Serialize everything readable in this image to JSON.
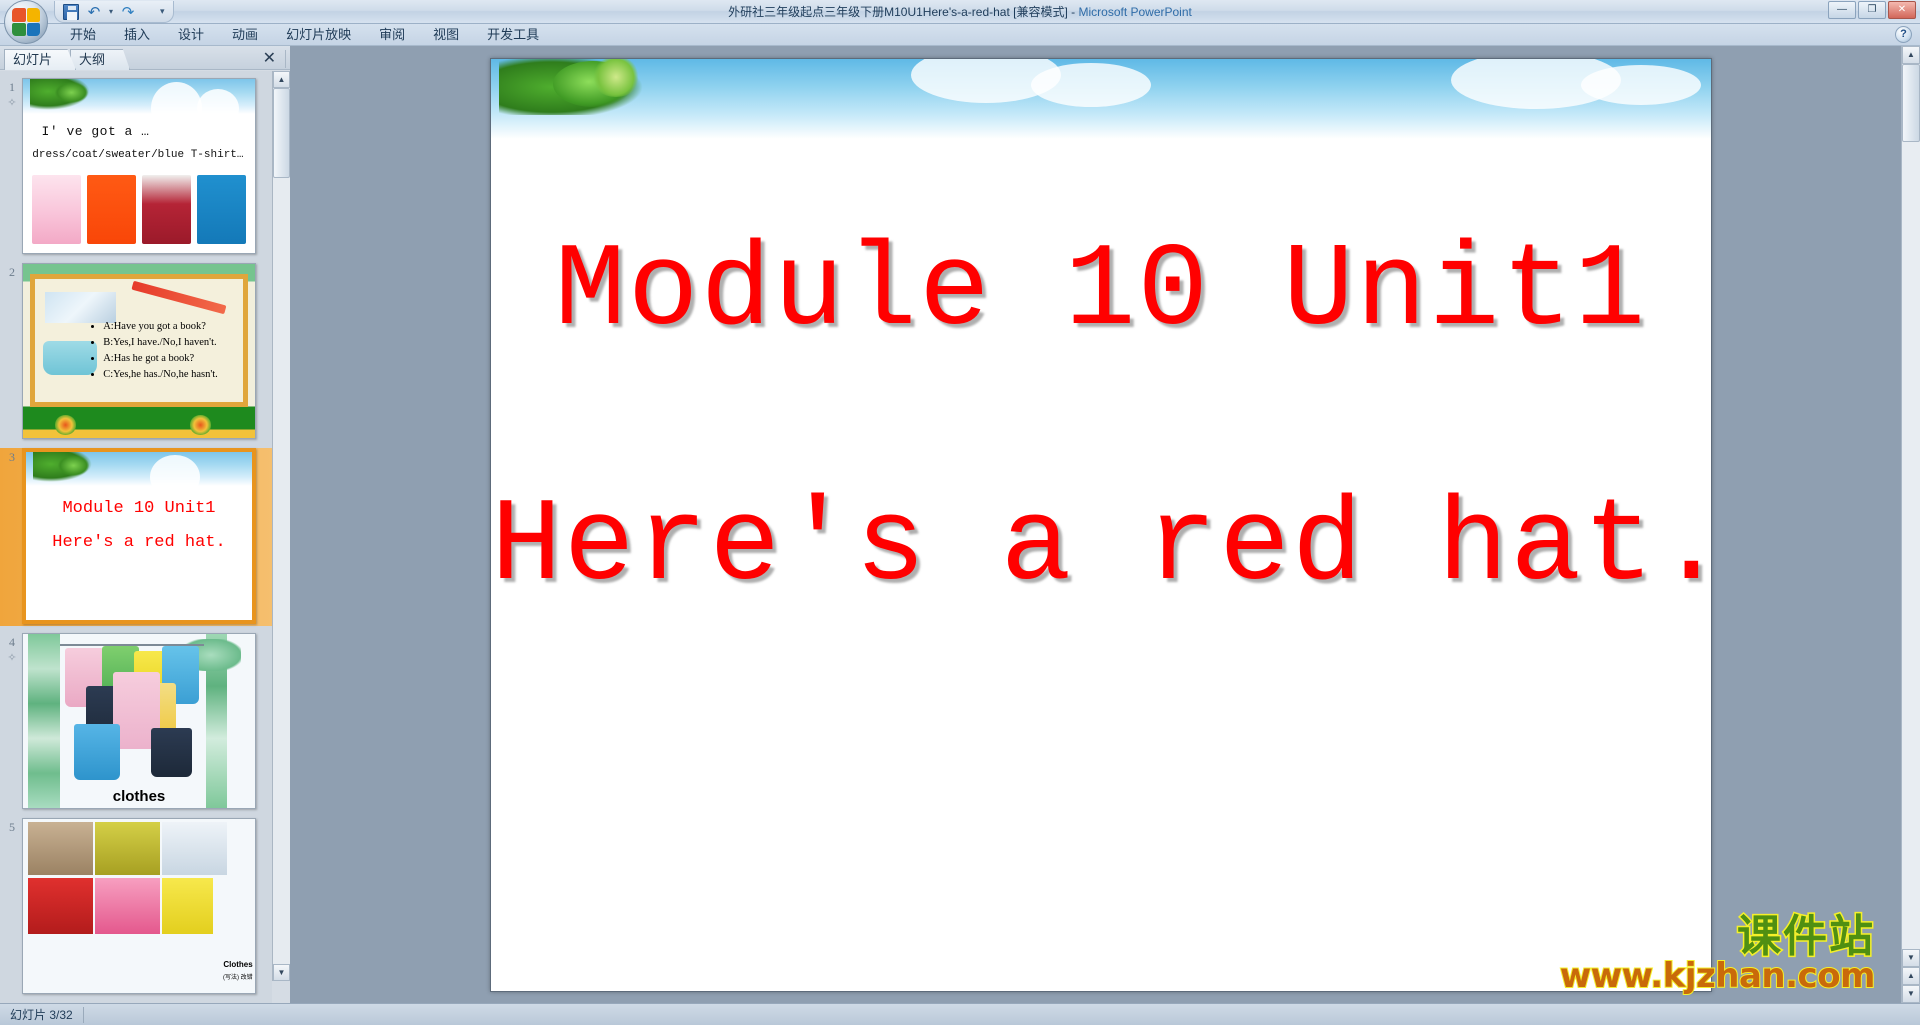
{
  "window": {
    "title": "外研社三年级起点三年级下册M10U1Here's-a-red-hat [兼容模式]",
    "separator": " - ",
    "app_name": "Microsoft PowerPoint",
    "minimize": "—",
    "restore": "❐",
    "close": "✕"
  },
  "quick_access": {
    "save_icon": "save-icon",
    "undo_icon": "undo-icon",
    "redo_icon": "redo-icon",
    "undo_glyph": "↶",
    "redo_glyph": "↷",
    "caret": "▾",
    "more": "▾"
  },
  "ribbon": {
    "tabs": [
      {
        "label": "开始"
      },
      {
        "label": "插入"
      },
      {
        "label": "设计"
      },
      {
        "label": "动画"
      },
      {
        "label": "幻灯片放映"
      },
      {
        "label": "审阅"
      },
      {
        "label": "视图"
      },
      {
        "label": "开发工具"
      }
    ],
    "help_label": "?"
  },
  "left_pane": {
    "tabs": [
      {
        "label": "幻灯片",
        "active": true
      },
      {
        "label": "大纲",
        "active": false
      }
    ],
    "close_label": "✕",
    "scroll": {
      "up": "▲",
      "down": "▼"
    }
  },
  "thumbnails": [
    {
      "number": "1",
      "star": "✧",
      "selected": false,
      "line1": "I' ve got a …",
      "line2": "dress/coat/sweater/blue T-shirt…"
    },
    {
      "number": "2",
      "star": "",
      "selected": false,
      "bullets": [
        "A:Have you got a book?",
        "B:Yes,I have./No,I haven't.",
        "A:Has he got a book?",
        "C:Yes,he has./No,he hasn't."
      ]
    },
    {
      "number": "3",
      "star": "",
      "selected": true,
      "title": "Module 10 Unit1",
      "subtitle": "Here's a red hat."
    },
    {
      "number": "4",
      "star": "✧",
      "selected": false,
      "label": "clothes"
    },
    {
      "number": "5",
      "star": "",
      "selected": false,
      "label": "Clothes",
      "sublabel": "(写法) 改错"
    }
  ],
  "slide": {
    "title": "Module 10 Unit1",
    "subtitle": "Here's a red hat.",
    "title_color": "#ff0000"
  },
  "watermark": {
    "brand_cn": "课件站",
    "url": "www.kjzhan.com",
    "brand_color": "#4f8f12",
    "url_color": "#c96a0a",
    "outline_color": "#f5f02a"
  },
  "canvas_scroll": {
    "up": "▲",
    "down": "▼",
    "prev": "▲",
    "next": "▼",
    "all": "▾"
  },
  "statusbar": {
    "slide_count": "幻灯片 3/32"
  }
}
